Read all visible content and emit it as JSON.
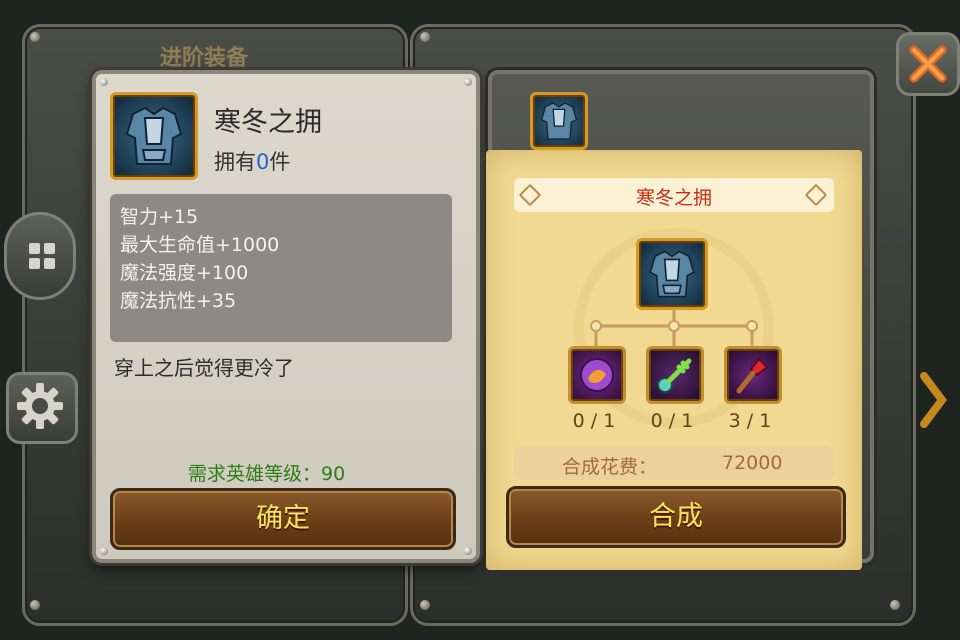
{
  "background": {
    "header": "进阶装备"
  },
  "item_panel": {
    "name": "寒冬之拥",
    "owned_prefix": "拥有",
    "owned_count": "0",
    "owned_suffix": "件",
    "stats": [
      "智力+15",
      "最大生命值+1000",
      "魔法强度+100",
      "魔法抗性+35"
    ],
    "description": "穿上之后觉得更冷了",
    "required_level": "需求英雄等级：90",
    "confirm_label": "确定"
  },
  "craft_panel": {
    "recipe_name": "寒冬之拥",
    "materials": [
      {
        "icon": "purple-orb-icon",
        "count": "0 / 1"
      },
      {
        "icon": "green-key-icon",
        "count": "0 / 1"
      },
      {
        "icon": "red-gem-staff-icon",
        "count": "3 / 1"
      }
    ],
    "cost_label": "合成花费：",
    "cost_value": "72000",
    "craft_label": "合成"
  },
  "colors": {
    "button_text": "#ffe05a",
    "recipe_name": "#d22a14",
    "required_level": "#2f7d18",
    "owned_count": "#1f5fd8"
  }
}
